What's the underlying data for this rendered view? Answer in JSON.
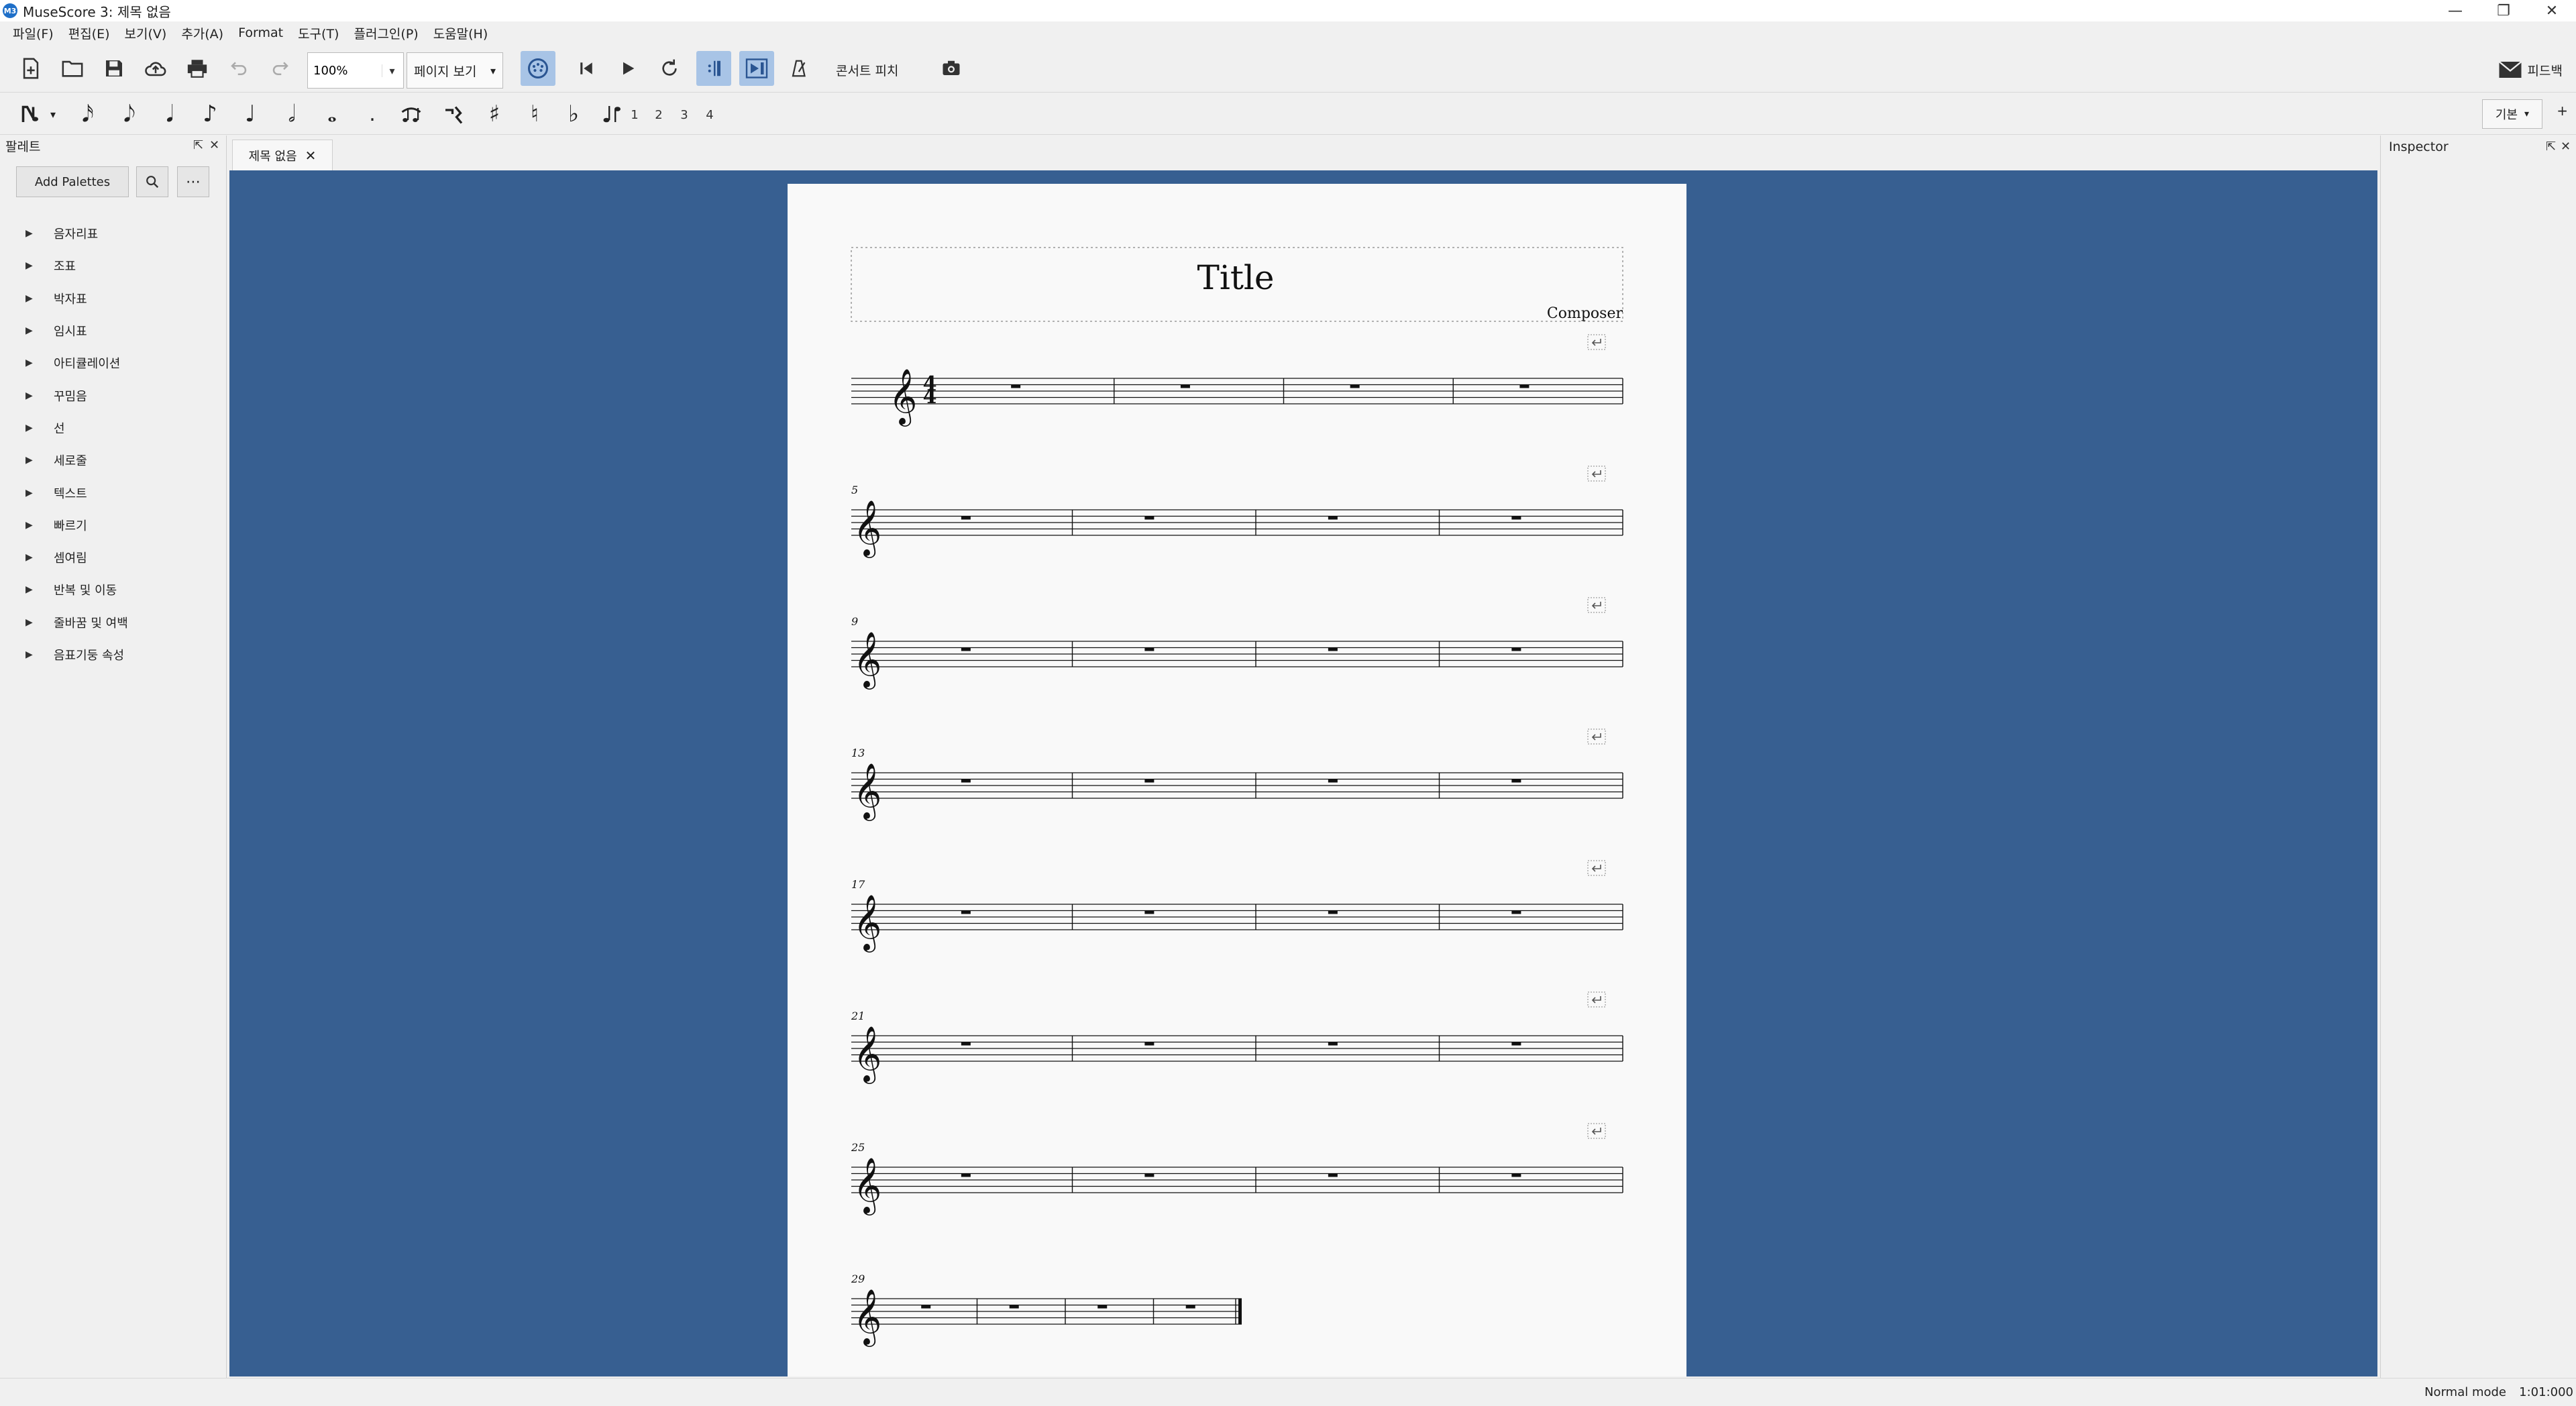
{
  "window": {
    "title": "MuseScore 3: 제목 없음",
    "app_badge": "M3"
  },
  "menu": [
    "파일(F)",
    "편집(E)",
    "보기(V)",
    "추가(A)",
    "Format",
    "도구(T)",
    "플러그인(P)",
    "도움말(H)"
  ],
  "toolbar": {
    "zoom_value": "100%",
    "view_mode": "페이지 보기",
    "concert_pitch": "콘서트 피치",
    "feedback": "피드백"
  },
  "note_input": {
    "voices": [
      "1",
      "2",
      "3",
      "4"
    ]
  },
  "workspace": {
    "selected": "기본",
    "add": "+"
  },
  "palette": {
    "header": "팔레트",
    "add_palettes": "Add Palettes",
    "items": [
      "음자리표",
      "조표",
      "박자표",
      "임시표",
      "아티큘레이션",
      "꾸밈음",
      "선",
      "세로줄",
      "텍스트",
      "빠르기",
      "셈여림",
      "반복 및 이동",
      "줄바꿈 및 여백",
      "음표기둥 속성"
    ]
  },
  "tab": {
    "label": "제목 없음"
  },
  "score": {
    "title": "Title",
    "composer": "Composer",
    "time_signature": {
      "numerator": "4",
      "denominator": "4"
    },
    "system_numbers": [
      "",
      "5",
      "9",
      "13",
      "17",
      "21",
      "25",
      "29"
    ],
    "measures_per_system": 4,
    "colors": {
      "canvas": "#375f91",
      "page": "#f9f9f9",
      "ink": "#111111"
    }
  },
  "inspector": {
    "header": "Inspector"
  },
  "status": {
    "mode": "Normal mode",
    "position": "1:01:000"
  }
}
